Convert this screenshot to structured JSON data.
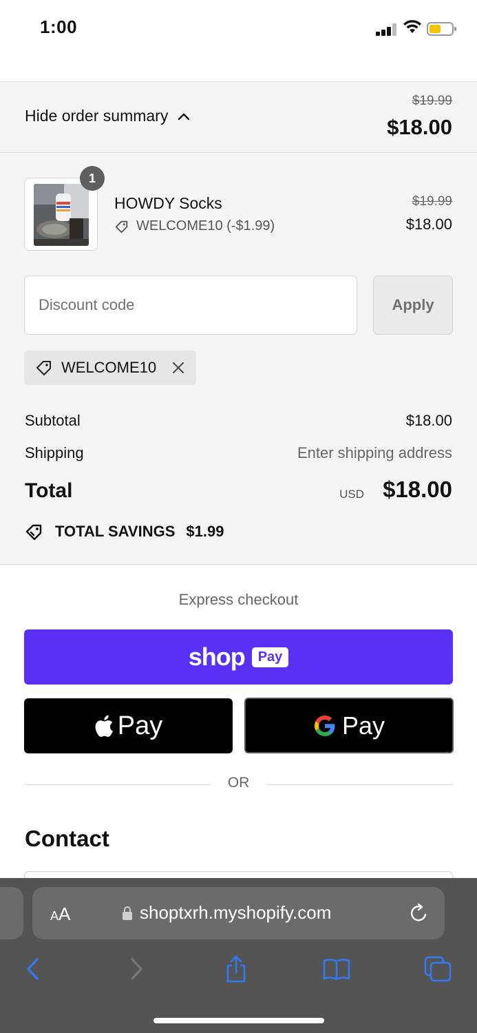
{
  "status_bar": {
    "time": "1:00"
  },
  "summary": {
    "toggle_label": "Hide order summary",
    "original_total": "$19.99",
    "total": "$18.00"
  },
  "product": {
    "quantity": "1",
    "name": "HOWDY Socks",
    "discount": "WELCOME10 (-$1.99)",
    "original_price": "$19.99",
    "price": "$18.00"
  },
  "discount_form": {
    "placeholder": "Discount code",
    "apply_label": "Apply",
    "applied_code": "WELCOME10"
  },
  "totals": {
    "subtotal_label": "Subtotal",
    "subtotal_value": "$18.00",
    "shipping_label": "Shipping",
    "shipping_value": "Enter shipping address",
    "total_label": "Total",
    "currency": "USD",
    "total_value": "$18.00",
    "savings_label": "TOTAL SAVINGS",
    "savings_value": "$1.99"
  },
  "express": {
    "label": "Express checkout",
    "shop_pay_word": "shop",
    "shop_pay_badge": "Pay",
    "apple_pay_label": "Pay",
    "google_pay_label": "Pay",
    "or_label": "OR"
  },
  "contact": {
    "heading": "Contact"
  },
  "browser": {
    "aa_label_small": "A",
    "aa_label_large": "A",
    "url": "shoptxrh.myshopify.com"
  },
  "colors": {
    "shop_pay": "#5a31f4",
    "ios_blue": "#3478f6",
    "panel_bg": "#f5f5f5"
  }
}
